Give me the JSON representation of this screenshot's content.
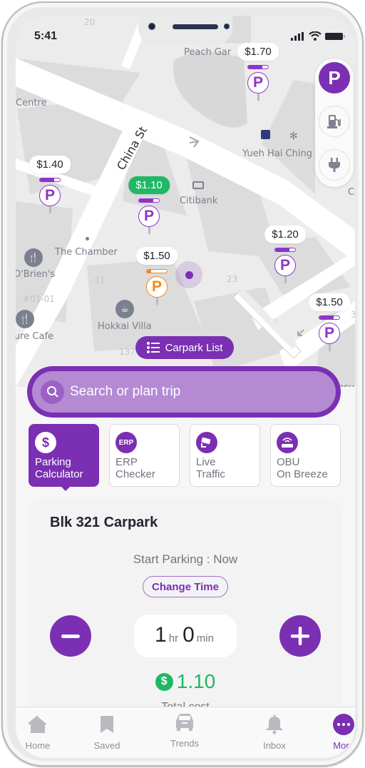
{
  "status_bar": {
    "time": "5:41"
  },
  "map": {
    "labels": {
      "peach_garden": "Peach Gar",
      "centre": "Centre",
      "yueh_hai_ching": "Yueh Hai Ching",
      "citibank": "Citibank",
      "the_chamber": "The Chamber",
      "obriens": "O'Brien's",
      "unit": "#01-01",
      "hokkai_villa": "Hokkai Villa",
      "cafe": "ure Cafe",
      "c_edge": "C",
      "nsu_edge": "nsu",
      "num_20": "20",
      "num_31": "31",
      "num_23": "23",
      "num_137": "137",
      "num_3": "3"
    },
    "street": "China St",
    "carparks": [
      {
        "price": "$1.70",
        "occupancy": 0.7,
        "style": "default"
      },
      {
        "price": "$1.40",
        "occupancy": 0.7,
        "style": "default"
      },
      {
        "price": "$1.10",
        "occupancy": 0.7,
        "style": "cheapest"
      },
      {
        "price": "$1.50",
        "occupancy": 0.2,
        "style": "warning"
      },
      {
        "price": "$1.20",
        "occupancy": 0.7,
        "style": "default"
      },
      {
        "price": "$1.50",
        "occupancy": 0.7,
        "style": "default"
      }
    ],
    "filter_panel": {
      "parking": "P",
      "fuel": "fuel-icon",
      "ev": "ev-plug-icon"
    },
    "carpark_list_label": "Carpark List"
  },
  "search": {
    "placeholder": "Search or plan trip"
  },
  "features": [
    {
      "line1": "Parking",
      "line2": "Calculator",
      "icon": "$",
      "active": true
    },
    {
      "line1": "ERP",
      "line2": "Checker",
      "icon": "ERP",
      "active": false
    },
    {
      "line1": "Live",
      "line2": "Traffic",
      "icon": "camera",
      "active": false
    },
    {
      "line1": "OBU",
      "line2": "On Breeze",
      "icon": "router",
      "active": false
    }
  ],
  "calculator": {
    "carpark_name": "Blk 321 Carpark",
    "start_parking": "Start Parking : Now",
    "change_time_label": "Change Time",
    "hours": "1",
    "hours_unit": "hr",
    "minutes": "0",
    "minutes_unit": "min",
    "cost_symbol": "$",
    "cost": "1.10",
    "cost_label": "Total cost"
  },
  "tabs": [
    {
      "label": "Home",
      "active": false
    },
    {
      "label": "Saved",
      "active": false
    },
    {
      "label": "Trends",
      "active": false
    },
    {
      "label": "Inbox",
      "active": false
    },
    {
      "label": "More",
      "active": true
    }
  ],
  "colors": {
    "brand": "#7b2fb3",
    "cheapest": "#1fb866",
    "warning": "#f08a1c"
  }
}
